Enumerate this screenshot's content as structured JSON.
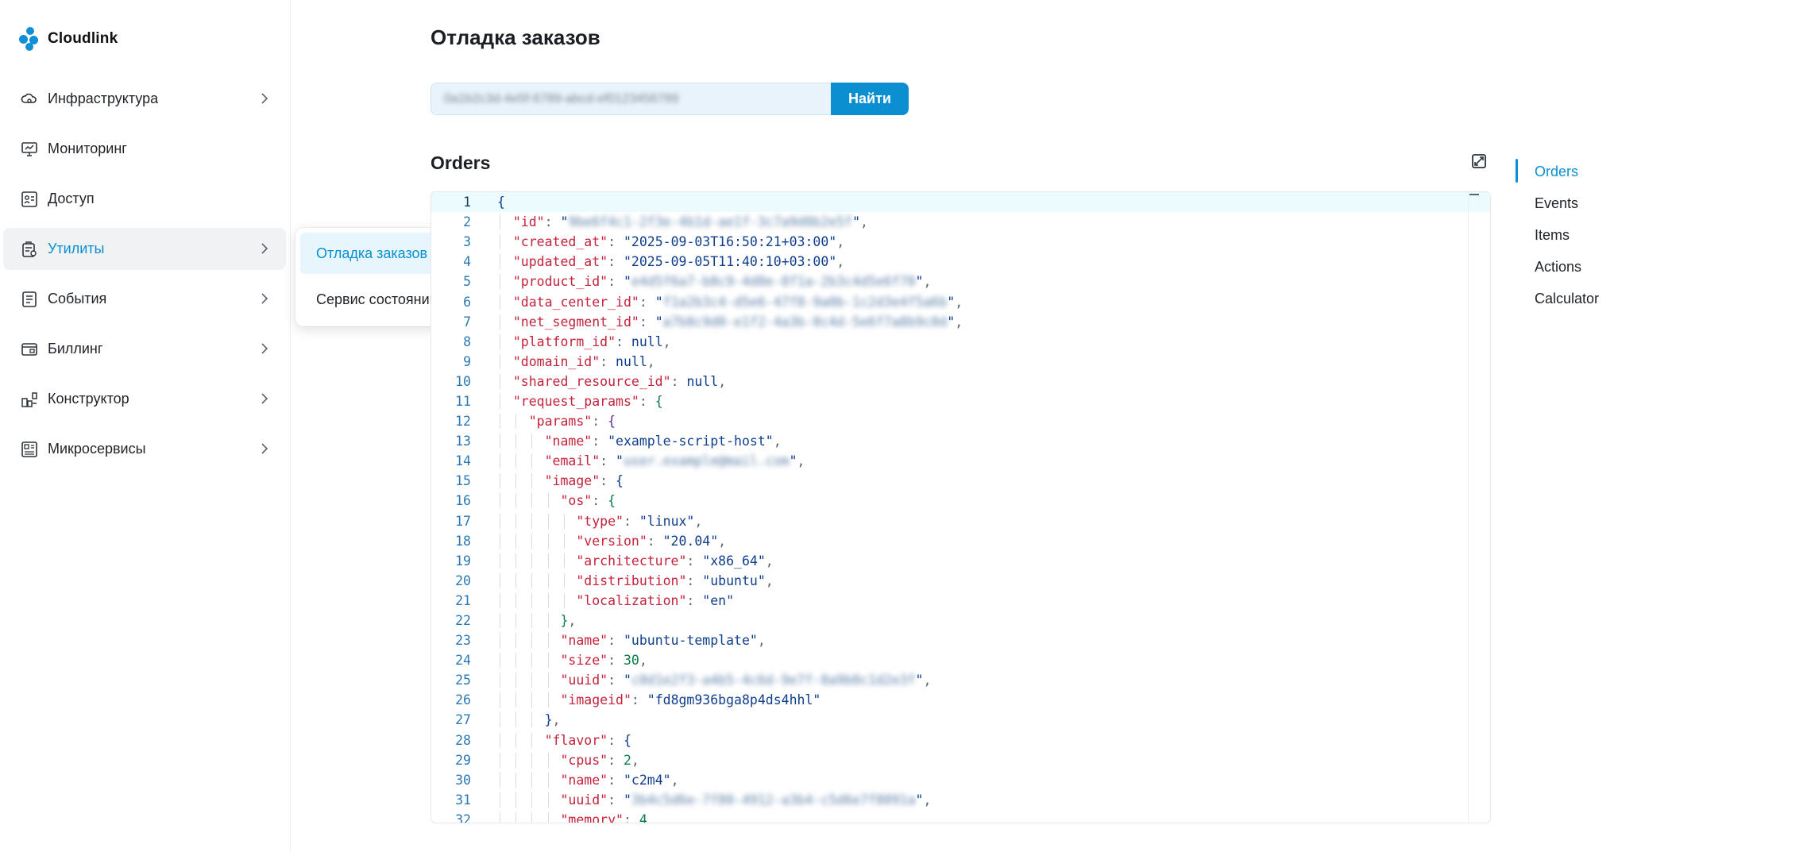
{
  "app": {
    "brand": "Cloudlink",
    "brand_color": "#0b8fd1"
  },
  "sidebar": {
    "items": [
      {
        "label": "Инфраструктура",
        "icon": "cloud-cog-icon",
        "has_chevron": true
      },
      {
        "label": "Мониторинг",
        "icon": "monitor-icon",
        "has_chevron": false
      },
      {
        "label": "Доступ",
        "icon": "access-icon",
        "has_chevron": false
      },
      {
        "label": "Утилиты",
        "icon": "utilities-icon",
        "has_chevron": true,
        "active": true
      },
      {
        "label": "События",
        "icon": "events-icon",
        "has_chevron": true
      },
      {
        "label": "Биллинг",
        "icon": "billing-icon",
        "has_chevron": true
      },
      {
        "label": "Конструктор",
        "icon": "constructor-icon",
        "has_chevron": true
      },
      {
        "label": "Микросервисы",
        "icon": "microservices-icon",
        "has_chevron": true
      }
    ]
  },
  "submenu": {
    "items": [
      {
        "label": "Отладка заказов",
        "active": true
      },
      {
        "label": "Сервис состояний",
        "active": false
      }
    ]
  },
  "main": {
    "title": "Отладка заказов",
    "search": {
      "value": "0a1b2c3d-4e5f-6789-abcd-ef0123456789",
      "button_label": "Найти"
    },
    "section_title": "Orders"
  },
  "toc": {
    "items": [
      {
        "label": "Orders",
        "active": true
      },
      {
        "label": "Events",
        "active": false
      },
      {
        "label": "Items",
        "active": false
      },
      {
        "label": "Actions",
        "active": false
      },
      {
        "label": "Calculator",
        "active": false
      }
    ]
  },
  "code_lines": [
    {
      "n": 1,
      "depth": 0,
      "parts": [
        [
          "br0",
          "{"
        ]
      ]
    },
    {
      "n": 2,
      "depth": 1,
      "parts": [
        [
          "k",
          "\"id\""
        ],
        [
          "p",
          ": "
        ],
        [
          "s",
          "\""
        ],
        [
          "blur",
          "9be6f4c1-2f3e-4b1d-ae1f-3c7a9d0b2e5f"
        ],
        [
          "s",
          "\""
        ],
        [
          "p",
          ","
        ]
      ]
    },
    {
      "n": 3,
      "depth": 1,
      "parts": [
        [
          "k",
          "\"created_at\""
        ],
        [
          "p",
          ": "
        ],
        [
          "s",
          "\"2025-09-03T16:50:21+03:00\""
        ],
        [
          "p",
          ","
        ]
      ]
    },
    {
      "n": 4,
      "depth": 1,
      "parts": [
        [
          "k",
          "\"updated_at\""
        ],
        [
          "p",
          ": "
        ],
        [
          "s",
          "\"2025-09-05T11:40:10+03:00\""
        ],
        [
          "p",
          ","
        ]
      ]
    },
    {
      "n": 5,
      "depth": 1,
      "parts": [
        [
          "k",
          "\"product_id\""
        ],
        [
          "p",
          ": "
        ],
        [
          "s",
          "\""
        ],
        [
          "blur",
          "e4d5f6a7-b8c9-4d0e-8f1a-2b3c4d5e6f70"
        ],
        [
          "s",
          "\""
        ],
        [
          "p",
          ","
        ]
      ]
    },
    {
      "n": 6,
      "depth": 1,
      "parts": [
        [
          "k",
          "\"data_center_id\""
        ],
        [
          "p",
          ": "
        ],
        [
          "s",
          "\""
        ],
        [
          "blur",
          "f1a2b3c4-d5e6-47f8-9a0b-1c2d3e4f5a6b"
        ],
        [
          "s",
          "\""
        ],
        [
          "p",
          ","
        ]
      ]
    },
    {
      "n": 7,
      "depth": 1,
      "parts": [
        [
          "k",
          "\"net_segment_id\""
        ],
        [
          "p",
          ": "
        ],
        [
          "s",
          "\""
        ],
        [
          "blur",
          "a7b8c9d0-e1f2-4a3b-8c4d-5e6f7a8b9c0d"
        ],
        [
          "s",
          "\""
        ],
        [
          "p",
          ","
        ]
      ]
    },
    {
      "n": 8,
      "depth": 1,
      "parts": [
        [
          "k",
          "\"platform_id\""
        ],
        [
          "p",
          ": "
        ],
        [
          "b",
          "null"
        ],
        [
          "p",
          ","
        ]
      ]
    },
    {
      "n": 9,
      "depth": 1,
      "parts": [
        [
          "k",
          "\"domain_id\""
        ],
        [
          "p",
          ": "
        ],
        [
          "b",
          "null"
        ],
        [
          "p",
          ","
        ]
      ]
    },
    {
      "n": 10,
      "depth": 1,
      "parts": [
        [
          "k",
          "\"shared_resource_id\""
        ],
        [
          "p",
          ": "
        ],
        [
          "b",
          "null"
        ],
        [
          "p",
          ","
        ]
      ]
    },
    {
      "n": 11,
      "depth": 1,
      "parts": [
        [
          "k",
          "\"request_params\""
        ],
        [
          "p",
          ": "
        ],
        [
          "br1",
          "{"
        ]
      ]
    },
    {
      "n": 12,
      "depth": 2,
      "parts": [
        [
          "k",
          "\"params\""
        ],
        [
          "p",
          ": "
        ],
        [
          "br2",
          "{"
        ]
      ]
    },
    {
      "n": 13,
      "depth": 3,
      "parts": [
        [
          "k",
          "\"name\""
        ],
        [
          "p",
          ": "
        ],
        [
          "s",
          "\"example-script-host\""
        ],
        [
          "p",
          ","
        ]
      ]
    },
    {
      "n": 14,
      "depth": 3,
      "parts": [
        [
          "k",
          "\"email\""
        ],
        [
          "p",
          ": "
        ],
        [
          "s",
          "\""
        ],
        [
          "blur",
          "user.example@mail.com"
        ],
        [
          "s",
          "\""
        ],
        [
          "p",
          ","
        ]
      ]
    },
    {
      "n": 15,
      "depth": 3,
      "parts": [
        [
          "k",
          "\"image\""
        ],
        [
          "p",
          ": "
        ],
        [
          "br0",
          "{"
        ]
      ]
    },
    {
      "n": 16,
      "depth": 4,
      "parts": [
        [
          "k",
          "\"os\""
        ],
        [
          "p",
          ": "
        ],
        [
          "br1",
          "{"
        ]
      ]
    },
    {
      "n": 17,
      "depth": 5,
      "parts": [
        [
          "k",
          "\"type\""
        ],
        [
          "p",
          ": "
        ],
        [
          "s",
          "\"linux\""
        ],
        [
          "p",
          ","
        ]
      ]
    },
    {
      "n": 18,
      "depth": 5,
      "parts": [
        [
          "k",
          "\"version\""
        ],
        [
          "p",
          ": "
        ],
        [
          "s",
          "\"20.04\""
        ],
        [
          "p",
          ","
        ]
      ]
    },
    {
      "n": 19,
      "depth": 5,
      "parts": [
        [
          "k",
          "\"architecture\""
        ],
        [
          "p",
          ": "
        ],
        [
          "s",
          "\"x86_64\""
        ],
        [
          "p",
          ","
        ]
      ]
    },
    {
      "n": 20,
      "depth": 5,
      "parts": [
        [
          "k",
          "\"distribution\""
        ],
        [
          "p",
          ": "
        ],
        [
          "s",
          "\"ubuntu\""
        ],
        [
          "p",
          ","
        ]
      ]
    },
    {
      "n": 21,
      "depth": 5,
      "parts": [
        [
          "k",
          "\"localization\""
        ],
        [
          "p",
          ": "
        ],
        [
          "s",
          "\"en\""
        ]
      ]
    },
    {
      "n": 22,
      "depth": 4,
      "parts": [
        [
          "br1",
          "}"
        ],
        [
          "p",
          ","
        ]
      ]
    },
    {
      "n": 23,
      "depth": 4,
      "parts": [
        [
          "k",
          "\"name\""
        ],
        [
          "p",
          ": "
        ],
        [
          "s",
          "\"ubuntu-template\""
        ],
        [
          "p",
          ","
        ]
      ]
    },
    {
      "n": 24,
      "depth": 4,
      "parts": [
        [
          "k",
          "\"size\""
        ],
        [
          "p",
          ": "
        ],
        [
          "n",
          "30"
        ],
        [
          "p",
          ","
        ]
      ]
    },
    {
      "n": 25,
      "depth": 4,
      "parts": [
        [
          "k",
          "\"uuid\""
        ],
        [
          "p",
          ": "
        ],
        [
          "s",
          "\""
        ],
        [
          "blur",
          "c0d1e2f3-a4b5-4c6d-9e7f-8a9b0c1d2e3f"
        ],
        [
          "s",
          "\""
        ],
        [
          "p",
          ","
        ]
      ]
    },
    {
      "n": 26,
      "depth": 4,
      "parts": [
        [
          "k",
          "\"imageid\""
        ],
        [
          "p",
          ": "
        ],
        [
          "s",
          "\"fd8gm936bga8p4ds4hhl\""
        ]
      ]
    },
    {
      "n": 27,
      "depth": 3,
      "parts": [
        [
          "br0",
          "}"
        ],
        [
          "p",
          ","
        ]
      ]
    },
    {
      "n": 28,
      "depth": 3,
      "parts": [
        [
          "k",
          "\"flavor\""
        ],
        [
          "p",
          ": "
        ],
        [
          "br0",
          "{"
        ]
      ]
    },
    {
      "n": 29,
      "depth": 4,
      "parts": [
        [
          "k",
          "\"cpus\""
        ],
        [
          "p",
          ": "
        ],
        [
          "n",
          "2"
        ],
        [
          "p",
          ","
        ]
      ]
    },
    {
      "n": 30,
      "depth": 4,
      "parts": [
        [
          "k",
          "\"name\""
        ],
        [
          "p",
          ": "
        ],
        [
          "s",
          "\"c2m4\""
        ],
        [
          "p",
          ","
        ]
      ]
    },
    {
      "n": 31,
      "depth": 4,
      "parts": [
        [
          "k",
          "\"uuid\""
        ],
        [
          "p",
          ": "
        ],
        [
          "s",
          "\""
        ],
        [
          "blur",
          "3b4c5d6e-7f80-4912-a3b4-c5d6e7f8091a"
        ],
        [
          "s",
          "\""
        ],
        [
          "p",
          ","
        ]
      ]
    },
    {
      "n": 32,
      "depth": 4,
      "parts": [
        [
          "k",
          "\"memory\""
        ],
        [
          "p",
          ": "
        ],
        [
          "n",
          "4"
        ]
      ]
    }
  ]
}
